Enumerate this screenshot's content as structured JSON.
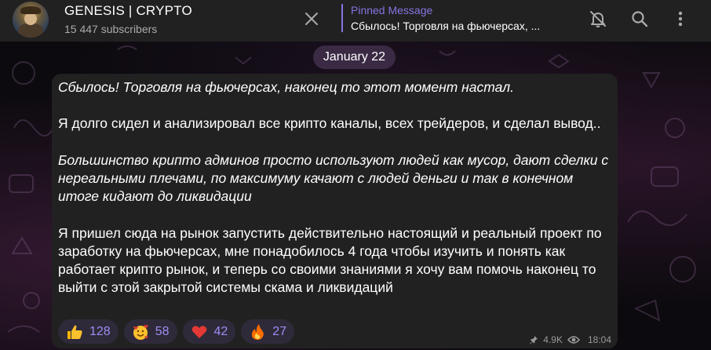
{
  "header": {
    "channel_title": "GENESIS | CRYPTO",
    "subscribers": "15 447 subscribers",
    "pinned_label": "Pinned Message",
    "pinned_text": "Сбылось! Торговля на фьючерсах, ..."
  },
  "icons": {
    "close": "close-icon",
    "mute": "bell-off-icon",
    "search": "search-icon",
    "menu": "more-vertical-icon"
  },
  "date_label": "January 22",
  "message": {
    "p1": "Сбылось! Торговля на фьючерсах, наконец то этот момент настал.",
    "p2": "Я долго сидел и анализировал все крипто каналы, всех трейдеров, и сделал вывод..",
    "p3": "Большинство крипто админов просто используют людей как мусор, дают сделки с нереальными плечами, по максимуму качают с людей деньги и так в конечном итоге кидают до ликвидации",
    "p4": "Я пришел сюда на рынок запустить действительно настоящий и реальный проект по заработку на фьючерсах, мне понадобилось 4 года чтобы изучить и понять как работает крипто рынок, и теперь со своими знаниями я хочу вам помочь наконец то выйти с этой закрытой системы скама и ликвидаций"
  },
  "reactions": [
    {
      "emoji": "thumbs-up",
      "count": "128"
    },
    {
      "emoji": "smiling-face-with-hearts",
      "count": "58"
    },
    {
      "emoji": "red-heart",
      "count": "42"
    },
    {
      "emoji": "fire",
      "count": "27"
    }
  ],
  "meta": {
    "views": "4.9K",
    "time": "18:04"
  },
  "colors": {
    "accent": "#8774e1",
    "header_bg": "#212121",
    "bubble_bg": "#212121",
    "reaction_bg": "#2f2a3a",
    "reaction_count": "#a08cf0"
  }
}
